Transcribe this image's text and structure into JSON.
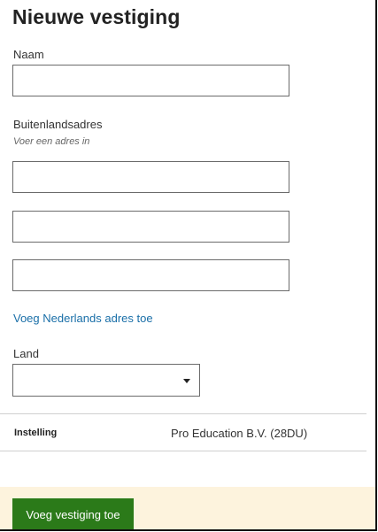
{
  "page": {
    "title": "Nieuwe vestiging"
  },
  "form": {
    "name_label": "Naam",
    "name_value": "",
    "address_label": "Buitenlandsadres",
    "address_hint": "Voer een adres in",
    "address_line1": "",
    "address_line2": "",
    "address_line3": "",
    "add_dutch_address_link": "Voeg Nederlands adres toe",
    "country_label": "Land",
    "country_value": ""
  },
  "details": {
    "institution_label": "Instelling",
    "institution_value": "Pro Education B.V. (28DU)"
  },
  "actions": {
    "submit_label": "Voeg vestiging toe"
  },
  "colors": {
    "primary_button": "#2b7a19",
    "link": "#1a6fa8",
    "footer_background": "#fdf3dd"
  },
  "icons": {
    "dropdown": "caret-down-icon"
  }
}
